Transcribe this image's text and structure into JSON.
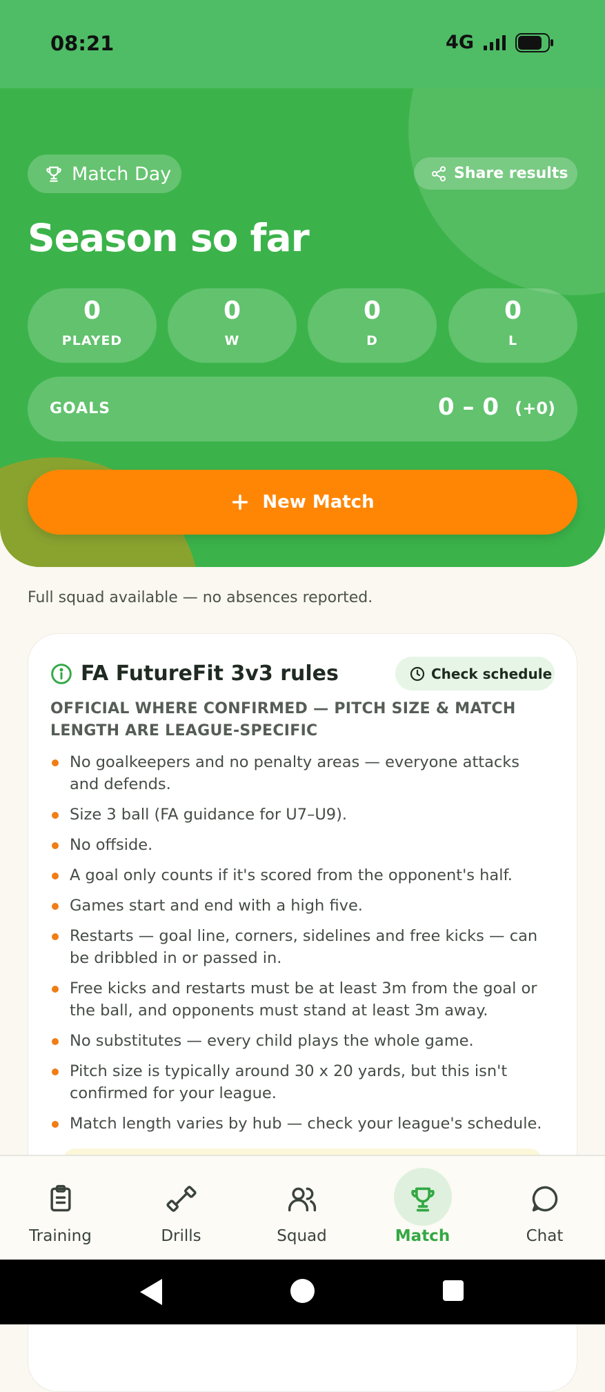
{
  "status": {
    "time": "08:21",
    "network": "4G"
  },
  "hero": {
    "badge": "Match Day",
    "share": "Share results",
    "title": "Season so far",
    "stats": [
      {
        "value": "0",
        "label": "PLAYED"
      },
      {
        "value": "0",
        "label": "W"
      },
      {
        "value": "0",
        "label": "D"
      },
      {
        "value": "0",
        "label": "L"
      }
    ],
    "goals": {
      "label": "GOALS",
      "score": "0 – 0",
      "diff": "(+0)"
    },
    "new_match": "New Match"
  },
  "availability": "Full squad available — no absences reported.",
  "rules_card": {
    "title": "FA FutureFit 3v3 rules",
    "check_schedule": "Check schedule",
    "subtitle": "OFFICIAL WHERE CONFIRMED — PITCH SIZE & MATCH LENGTH ARE LEAGUE-SPECIFIC",
    "rules": [
      "No goalkeepers and no penalty areas — everyone attacks and defends.",
      "Size 3 ball (FA guidance for U7–U9).",
      "No offside.",
      "A goal only counts if it's scored from the opponent's half.",
      "Games start and end with a high five.",
      "Restarts — goal line, corners, sidelines and free kicks — can be dribbled in or passed in.",
      "Free kicks and restarts must be at least 3m from the goal or the ball, and opponents must stand at least 3m away.",
      "No substitutes — every child plays the whole game.",
      "Pitch size is typically around 30 x 20 yards, but this isn't confirmed for your league.",
      "Match length varies by hub — check your league's schedule."
    ]
  },
  "nav": {
    "items": [
      {
        "label": "Training",
        "icon": "clipboard-icon"
      },
      {
        "label": "Drills",
        "icon": "dumbbell-icon"
      },
      {
        "label": "Squad",
        "icon": "users-icon"
      },
      {
        "label": "Match",
        "icon": "trophy-icon"
      },
      {
        "label": "Chat",
        "icon": "chat-icon"
      }
    ],
    "active": "Match"
  },
  "colors": {
    "green": "#3bb34a",
    "orange": "#ff8604",
    "active_nav": "#34a844"
  }
}
